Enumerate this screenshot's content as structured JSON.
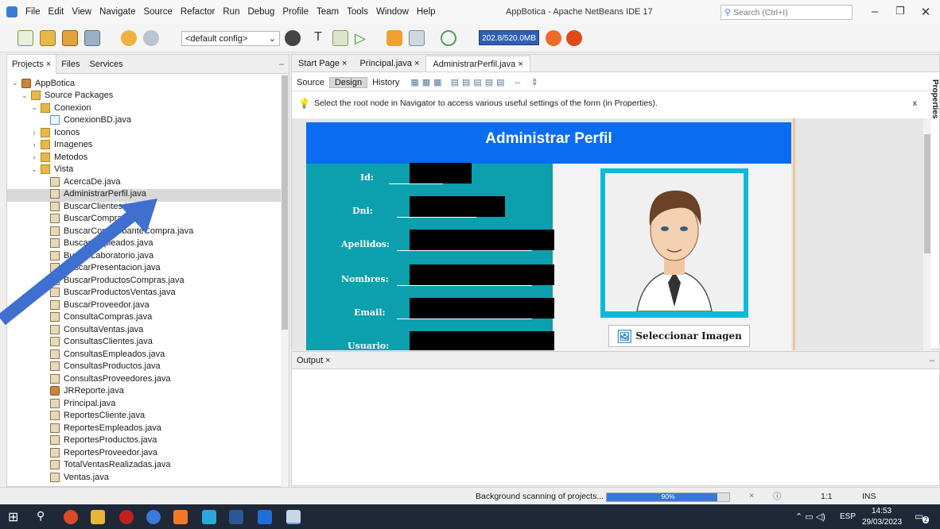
{
  "window": {
    "title": "AppBotica - Apache NetBeans IDE 17",
    "menus": [
      "File",
      "Edit",
      "View",
      "Navigate",
      "Source",
      "Refactor",
      "Run",
      "Debug",
      "Profile",
      "Team",
      "Tools",
      "Window",
      "Help"
    ],
    "search_placeholder": "Search (Ctrl+I)"
  },
  "toolbar": {
    "config": "<default config>",
    "memory": "202.8/520.0MB"
  },
  "left_panel": {
    "tabs": [
      "Projects ×",
      "Files",
      "Services"
    ],
    "tree": [
      {
        "label": "AppBotica",
        "depth": 0,
        "toggle": "⌄",
        "icon": "proj"
      },
      {
        "label": "Source Packages",
        "depth": 1,
        "toggle": "⌄",
        "icon": "pkg"
      },
      {
        "label": "Conexion",
        "depth": 2,
        "toggle": "⌄",
        "icon": "pkg"
      },
      {
        "label": "ConexionBD.java",
        "depth": 3,
        "toggle": "",
        "icon": "file"
      },
      {
        "label": "Iconos",
        "depth": 2,
        "toggle": "›",
        "icon": "pkg"
      },
      {
        "label": "Imagenes",
        "depth": 2,
        "toggle": "›",
        "icon": "pkg"
      },
      {
        "label": "Metodos",
        "depth": 2,
        "toggle": "›",
        "icon": "pkg"
      },
      {
        "label": "Vista",
        "depth": 2,
        "toggle": "⌄",
        "icon": "pkg"
      },
      {
        "label": "AcercaDe.java",
        "depth": 3,
        "toggle": "",
        "icon": "form"
      },
      {
        "label": "AdministrarPerfil.java",
        "depth": 3,
        "toggle": "",
        "icon": "form"
      },
      {
        "label": "BuscarClientes.java",
        "depth": 3,
        "toggle": "",
        "icon": "form"
      },
      {
        "label": "BuscarCompras.java",
        "depth": 3,
        "toggle": "",
        "icon": "form"
      },
      {
        "label": "BuscarComprobanteCompra.java",
        "depth": 3,
        "toggle": "",
        "icon": "form"
      },
      {
        "label": "BuscarEmpleados.java",
        "depth": 3,
        "toggle": "",
        "icon": "form"
      },
      {
        "label": "BuscarLaboratorio.java",
        "depth": 3,
        "toggle": "",
        "icon": "form"
      },
      {
        "label": "BuscarPresentacion.java",
        "depth": 3,
        "toggle": "",
        "icon": "form"
      },
      {
        "label": "BuscarProductosCompras.java",
        "depth": 3,
        "toggle": "",
        "icon": "form"
      },
      {
        "label": "BuscarProductosVentas.java",
        "depth": 3,
        "toggle": "",
        "icon": "form"
      },
      {
        "label": "BuscarProveedor.java",
        "depth": 3,
        "toggle": "",
        "icon": "form"
      },
      {
        "label": "ConsultaCompras.java",
        "depth": 3,
        "toggle": "",
        "icon": "form"
      },
      {
        "label": "ConsultaVentas.java",
        "depth": 3,
        "toggle": "",
        "icon": "form"
      },
      {
        "label": "ConsultasClientes.java",
        "depth": 3,
        "toggle": "",
        "icon": "form"
      },
      {
        "label": "ConsultasEmpleados.java",
        "depth": 3,
        "toggle": "",
        "icon": "form"
      },
      {
        "label": "ConsultasProductos.java",
        "depth": 3,
        "toggle": "",
        "icon": "form"
      },
      {
        "label": "ConsultasProveedores.java",
        "depth": 3,
        "toggle": "",
        "icon": "form"
      },
      {
        "label": "JRReporte.java",
        "depth": 3,
        "toggle": "",
        "icon": "proj"
      },
      {
        "label": "Principal.java",
        "depth": 3,
        "toggle": "",
        "icon": "form"
      },
      {
        "label": "ReportesCliente.java",
        "depth": 3,
        "toggle": "",
        "icon": "form"
      },
      {
        "label": "ReportesEmpleados.java",
        "depth": 3,
        "toggle": "",
        "icon": "form"
      },
      {
        "label": "ReportesProductos.java",
        "depth": 3,
        "toggle": "",
        "icon": "form"
      },
      {
        "label": "ReportesProveedor.java",
        "depth": 3,
        "toggle": "",
        "icon": "form"
      },
      {
        "label": "TotalVentasRealizadas.java",
        "depth": 3,
        "toggle": "",
        "icon": "form"
      },
      {
        "label": "Ventas.java",
        "depth": 3,
        "toggle": "",
        "icon": "form"
      }
    ]
  },
  "editor": {
    "tabs": [
      "Start Page ×",
      "Principal.java ×",
      "AdministrarPerfil.java ×"
    ],
    "modes": [
      "Source",
      "Design",
      "History"
    ],
    "hint": "Select the root node in Navigator to access various useful settings of the form (in Properties).",
    "hint_close": "x",
    "props_label": "Properties"
  },
  "form": {
    "title": "Administrar Perfil",
    "fields": [
      "Id:",
      "Dni:",
      "Apellidos:",
      "Nombres:",
      "Email:",
      "Usuario:"
    ],
    "select_image": "Seleccionar Imagen"
  },
  "output": {
    "tab": "Output ×"
  },
  "status": {
    "scanning": "Background scanning of projects...",
    "progress": 90,
    "progress_label": "90%",
    "position": "1:1",
    "mode": "INS"
  },
  "taskbar": {
    "lang": "ESP",
    "time": "14:53",
    "date": "29/03/2023",
    "notif": "2"
  }
}
